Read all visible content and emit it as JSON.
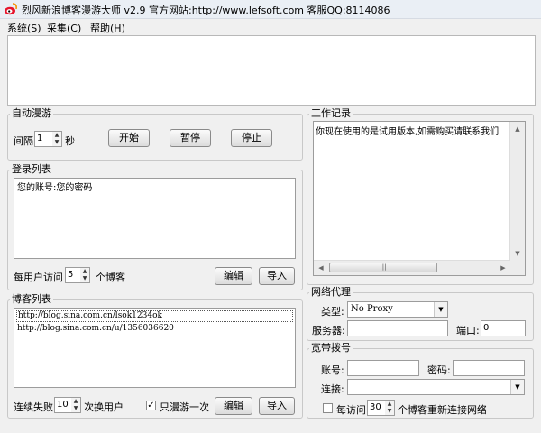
{
  "window": {
    "title": "烈风新浪博客漫游大师 v2.9 官方网站:http://www.lefsoft.com 客服QQ:8114086"
  },
  "menu": {
    "system": "系统(S)",
    "collect": "采集(C)",
    "help": "帮助(H)"
  },
  "auto_roam": {
    "legend": "自动漫游",
    "interval_label": "间隔",
    "interval_value": "1",
    "seconds_label": "秒",
    "start": "开始",
    "pause": "暂停",
    "stop": "停止"
  },
  "login_list": {
    "legend": "登录列表",
    "entry": "您的账号:您的密码",
    "per_user_label": "每用户访问",
    "per_user_value": "5",
    "blogs_label": "个博客",
    "edit": "编辑",
    "import": "导入"
  },
  "blog_list": {
    "legend": "博客列表",
    "items": [
      "http://blog.sina.com.cn/lsok1234ok",
      "http://blog.sina.com.cn/u/1356036620"
    ],
    "fail_label": "连续失败",
    "fail_value": "10",
    "switch_label": "次换用户",
    "roam_once_label": "只漫游一次",
    "roam_once_checked": true,
    "edit": "编辑",
    "import": "导入"
  },
  "work_log": {
    "legend": "工作记录",
    "text": "你现在使用的是试用版本,如需购买请联系我们"
  },
  "proxy": {
    "legend": "网络代理",
    "type_label": "类型:",
    "type_value": "No Proxy",
    "server_label": "服务器:",
    "server_value": "",
    "port_label": "端口:",
    "port_value": "0"
  },
  "dialup": {
    "legend": "宽带拨号",
    "account_label": "账号:",
    "account_value": "",
    "password_label": "密码:",
    "password_value": "",
    "connection_label": "连接:",
    "connection_value": "",
    "every_label": "每访问",
    "every_value": "30",
    "reconnect_label": "个博客重新连接网络",
    "every_checked": false
  },
  "colors": {
    "window_bg": "#f0f0f0",
    "titlebar_bg": "#eaeff5"
  }
}
